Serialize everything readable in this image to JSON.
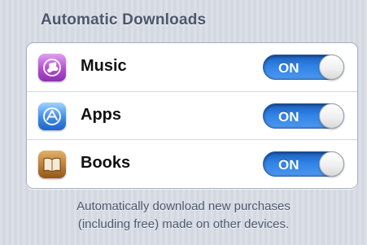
{
  "section": {
    "title": "Automatic Downloads"
  },
  "rows": [
    {
      "label": "Music",
      "icon": "music-icon",
      "toggle": "ON",
      "icon_color": "#b04fcf"
    },
    {
      "label": "Apps",
      "icon": "app-store-icon",
      "toggle": "ON",
      "icon_color": "#3f8be6"
    },
    {
      "label": "Books",
      "icon": "book-icon",
      "toggle": "ON",
      "icon_color": "#b97830"
    }
  ],
  "footer": {
    "line1": "Automatically download new purchases",
    "line2": "(including free) made on other devices."
  },
  "colors": {
    "toggle_on": "#2f83e6",
    "header_text": "#4c566c",
    "background": "#d7dce5"
  }
}
